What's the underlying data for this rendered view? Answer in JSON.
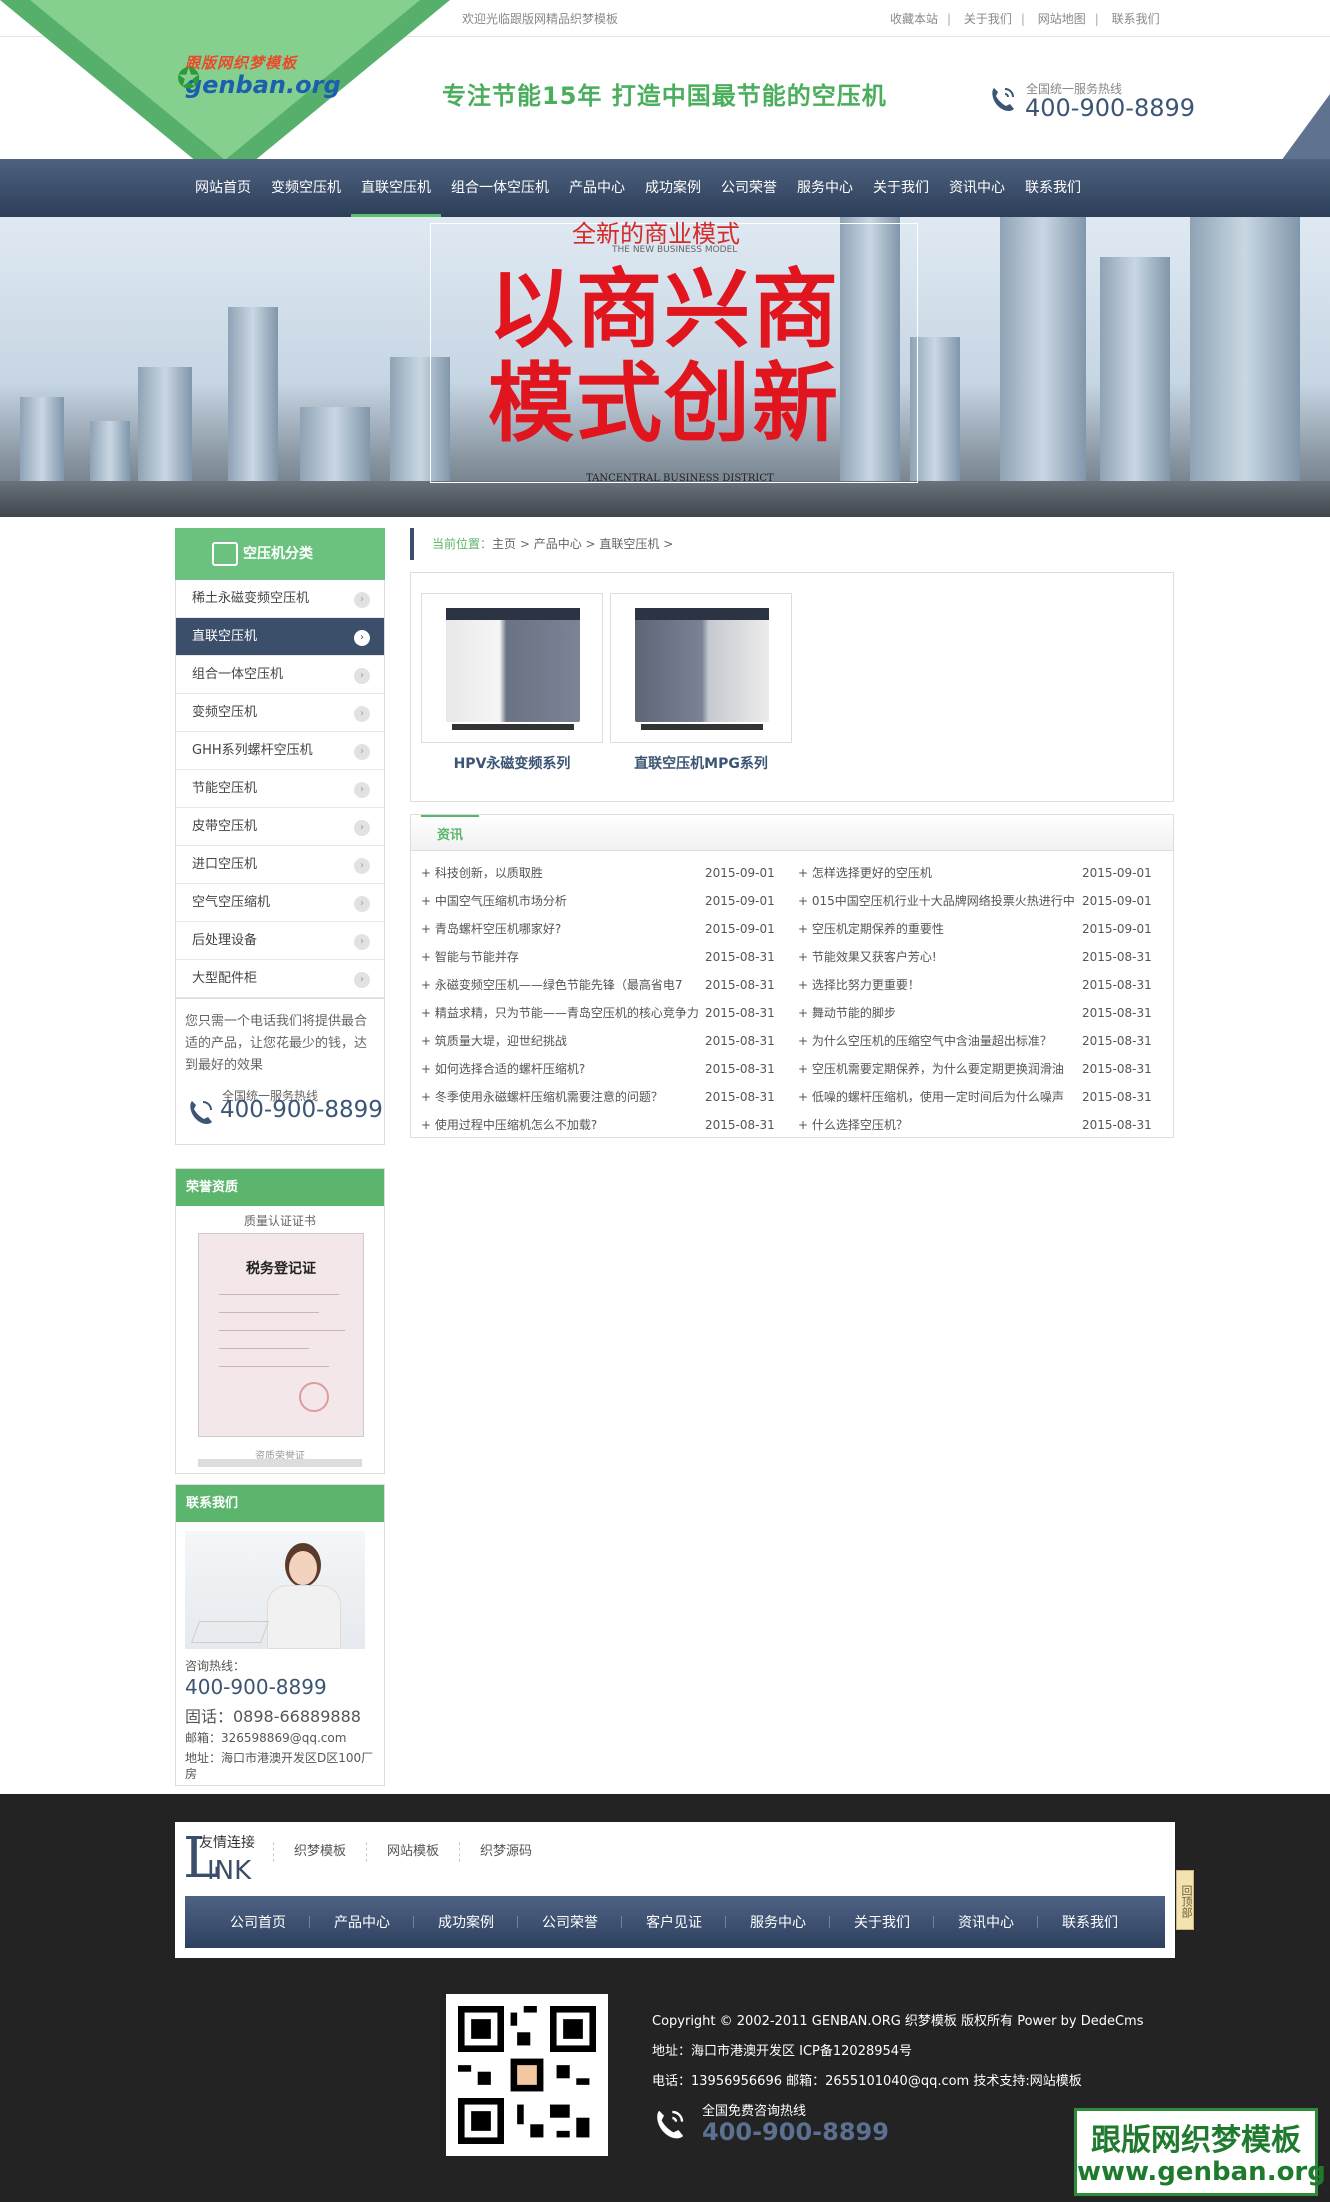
{
  "topbar": {
    "welcome": "欢迎光临跟版网精品织梦模板",
    "links": [
      "收藏本站",
      "关于我们",
      "网站地图",
      "联系我们"
    ]
  },
  "header": {
    "logo_line1": "跟版网织梦模板",
    "logo_line2": "genban.org",
    "slogan": "专注节能15年 打造中国最节能的空压机",
    "hotline_label": "全国统一服务热线",
    "hotline_number": "400-900-8899"
  },
  "nav": {
    "items": [
      "网站首页",
      "变频空压机",
      "直联空压机",
      "组合一体空压机",
      "产品中心",
      "成功案例",
      "公司荣誉",
      "服务中心",
      "关于我们",
      "资讯中心",
      "联系我们"
    ],
    "active": "直联空压机"
  },
  "banner": {
    "title": "全新的商业模式",
    "subtitle": "THE NEW BUSINESS MODEL",
    "big_line1": "以商兴商",
    "big_line2": "模式创新",
    "footer": "TANCENTRAL BUSINESS DISTRICT"
  },
  "sidebar": {
    "heading": "空压机分类",
    "categories": [
      "稀土永磁变频空压机",
      "直联空压机",
      "组合一体空压机",
      "变频空压机",
      "GHH系列螺杆空压机",
      "节能空压机",
      "皮带空压机",
      "进口空压机",
      "空气空压缩机",
      "后处理设备",
      "大型配件柜"
    ],
    "active": "直联空压机",
    "note": "您只需一个电话我们将提供最合适的产品，让您花最少的钱，达到最好的效果",
    "hotline_label": "全国统一服务热线",
    "hotline_number": "400-900-8899"
  },
  "honor": {
    "heading": "荣誉资质",
    "subtitle": "质量认证证书",
    "cert_title": "税务登记证",
    "caption": "资质荣誉证"
  },
  "contact": {
    "heading": "联系我们",
    "label": "咨询热线：",
    "phone": "400-900-8899",
    "fax": "固话：0898-66889888",
    "email": "邮箱：326598869@qq.com",
    "address_line1": "地址：海口市港澳开发区D区100厂",
    "address_line2": "房"
  },
  "breadcrumb": {
    "prefix": "当前位置：",
    "path": "主页 > 产品中心 > 直联空压机 >"
  },
  "products": [
    {
      "name": "HPV永磁变频系列"
    },
    {
      "name": "直联空压机MPG系列"
    }
  ],
  "news": {
    "heading": "资讯",
    "left": [
      {
        "title": "+ 科技创新，以质取胜",
        "date": "2015-09-01"
      },
      {
        "title": "+ 中国空气压缩机市场分析",
        "date": "2015-09-01"
      },
      {
        "title": "+ 青岛螺杆空压机哪家好?",
        "date": "2015-09-01"
      },
      {
        "title": "+ 智能与节能并存",
        "date": "2015-08-31"
      },
      {
        "title": "+ 永磁变频空压机——绿色节能先锋（最高省电7",
        "date": "2015-08-31"
      },
      {
        "title": "+ 精益求精，只为节能——青岛空压机的核心竞争力",
        "date": "2015-08-31"
      },
      {
        "title": "+ 筑质量大堤，迎世纪挑战",
        "date": "2015-08-31"
      },
      {
        "title": "+ 如何选择合适的螺杆压缩机?",
        "date": "2015-08-31"
      },
      {
        "title": "+ 冬季使用永磁螺杆压缩机需要注意的问题？",
        "date": "2015-08-31"
      },
      {
        "title": "+ 使用过程中压缩机怎么不加载?",
        "date": "2015-08-31"
      }
    ],
    "right": [
      {
        "title": "+ 怎样选择更好的空压机",
        "date": "2015-09-01"
      },
      {
        "title": "+ 015中国空压机行业十大品牌网络投票火热进行中",
        "date": "2015-09-01"
      },
      {
        "title": "+ 空压机定期保养的重要性",
        "date": "2015-09-01"
      },
      {
        "title": "+ 节能效果又获客户芳心!",
        "date": "2015-08-31"
      },
      {
        "title": "+ 选择比努力更重要！",
        "date": "2015-08-31"
      },
      {
        "title": "+ 舞动节能的脚步",
        "date": "2015-08-31"
      },
      {
        "title": "+ 为什么空压机的压缩空气中含油量超出标准？",
        "date": "2015-08-31"
      },
      {
        "title": "+ 空压机需要定期保养，为什么要定期更换润滑油",
        "date": "2015-08-31"
      },
      {
        "title": "+ 低噪的螺杆压缩机，使用一定时间后为什么噪声",
        "date": "2015-08-31"
      },
      {
        "title": "+ 什么选择空压机？",
        "date": "2015-08-31"
      }
    ]
  },
  "footer": {
    "link_label_cn": "友情连接",
    "link_label_L": "L",
    "link_label_rest": "INK",
    "friend_links": [
      "织梦模板",
      "网站模板",
      "织梦源码"
    ],
    "nav": [
      "公司首页",
      "产品中心",
      "成功案例",
      "公司荣誉",
      "客户见证",
      "服务中心",
      "关于我们",
      "资讯中心",
      "联系我们"
    ],
    "copyright": "Copyright © 2002-2011 GENBAN.ORG 织梦模板 版权所有 Power by DedeCms",
    "address": "地址：海口市港澳开发区 ICP备12028954号",
    "phone_email": "电话：13956956696 邮箱：2655101040@qq.com 技术支持:网站模板",
    "hotline_label": "全国免费咨询热线",
    "hotline_number": "400-900-8899",
    "back_top": "回顶部"
  },
  "watermark": {
    "line1": "跟版网织梦模板",
    "line2": "www.genban.org"
  },
  "colors": {
    "brand_green": "#5bb56d",
    "nav_blue": "#3b4f6b",
    "banner_red": "#e0151e"
  }
}
